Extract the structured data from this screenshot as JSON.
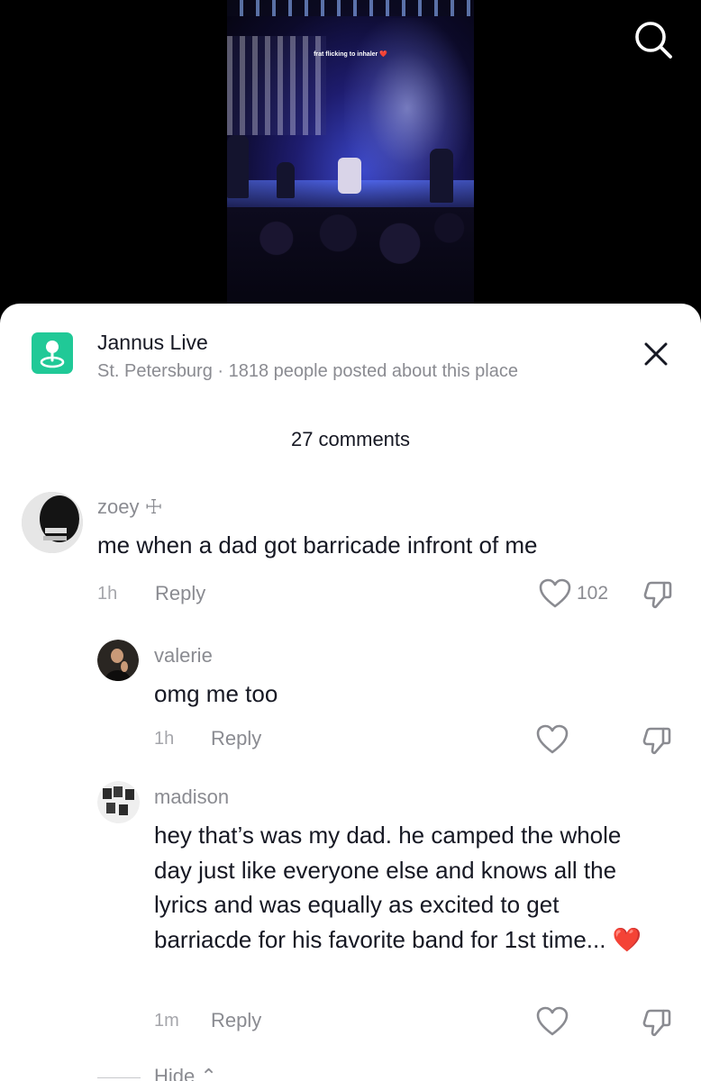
{
  "video": {
    "caption": "frat flicking to inhaler ❤️",
    "search_icon": "search-icon"
  },
  "place": {
    "icon": "location-pin-icon",
    "icon_color": "#20c997",
    "name": "Jannus Live",
    "subtitle": "St. Petersburg · 1818 people posted about this place",
    "close_icon": "close-icon"
  },
  "comments_count": "27 comments",
  "comments": [
    {
      "username": "zoey ☩",
      "text": "me when a dad got barricade infront of me",
      "time": "1h",
      "reply_label": "Reply",
      "likes": "102"
    },
    {
      "username": "valerie",
      "text": "omg me too",
      "time": "1h",
      "reply_label": "Reply"
    },
    {
      "username": "madison",
      "text": "hey that’s was my dad. he camped the whole day just like everyone else and knows all the lyrics and was equally as excited to get barriacde for his favorite band for 1st time... ❤️",
      "time": "1m",
      "reply_label": "Reply"
    }
  ],
  "hide_label": "Hide ⌃"
}
